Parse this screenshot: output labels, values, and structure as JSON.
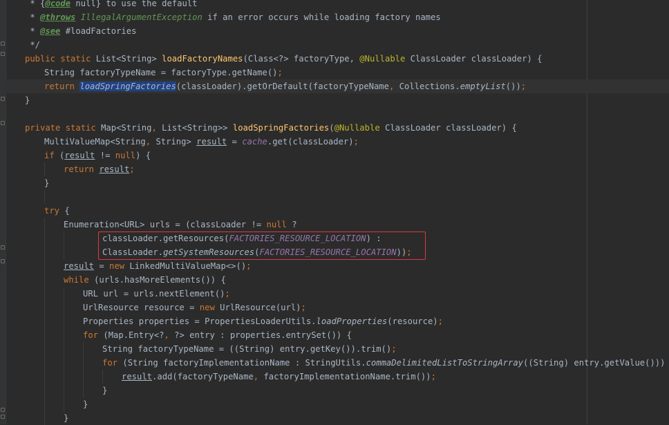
{
  "editor": {
    "language": "java",
    "colors": {
      "background": "#2b2b2b",
      "keyword": "#cc7832",
      "method": "#ffc66d",
      "field": "#9876aa",
      "annotation": "#bbb529",
      "comment": "#629755",
      "selection": "#214283",
      "highlight_box": "#e0383e"
    },
    "lines": [
      [
        {
          "t": " * {"
        },
        {
          "t": "@code",
          "c": "tg"
        },
        {
          "t": " null} to use the default"
        }
      ],
      [
        {
          "t": " * "
        },
        {
          "t": "@throws",
          "c": "tg"
        },
        {
          "t": " IllegalArgumentException",
          "c": "cm"
        },
        {
          "t": " if an error occurs while loading factory names"
        }
      ],
      [
        {
          "t": " * "
        },
        {
          "t": "@see",
          "c": "tg"
        },
        {
          "t": " #loadFactories"
        }
      ],
      [
        {
          "t": " */"
        }
      ],
      [
        {
          "t": "public static ",
          "c": "kw"
        },
        {
          "t": "List<String> "
        },
        {
          "t": "loadFactoryNames",
          "c": "fn"
        },
        {
          "t": "(Class<?> factoryType, "
        },
        {
          "t": "@Nullable",
          "c": "an"
        },
        {
          "t": " ClassLoader classLoader) {"
        }
      ],
      [
        {
          "t": "String factoryTypeName = factoryType.getName()"
        },
        {
          "t": ";",
          "c": "kw"
        }
      ],
      [
        {
          "t": "return ",
          "c": "kw"
        },
        {
          "t": "loadSpringFactories",
          "c": "st hl"
        },
        {
          "t": "(classLoader).getOrDefault(factoryTypeName"
        },
        {
          "t": ", ",
          "c": "kw"
        },
        {
          "t": "Collections."
        },
        {
          "t": "emptyList",
          "c": "st"
        },
        {
          "t": "())"
        },
        {
          "t": ";",
          "c": "kw"
        }
      ],
      [
        {
          "t": "}"
        }
      ],
      [],
      [
        {
          "t": "private static ",
          "c": "kw"
        },
        {
          "t": "Map<String"
        },
        {
          "t": ", ",
          "c": "kw"
        },
        {
          "t": "List<String>> "
        },
        {
          "t": "loadSpringFactories",
          "c": "fn"
        },
        {
          "t": "("
        },
        {
          "t": "@Nullable",
          "c": "an"
        },
        {
          "t": " ClassLoader classLoader) {"
        }
      ],
      [
        {
          "t": "MultiValueMap<String"
        },
        {
          "t": ", ",
          "c": "kw"
        },
        {
          "t": "String> "
        },
        {
          "t": "result",
          "c": "ul"
        },
        {
          "t": " = "
        },
        {
          "t": "cache",
          "c": "fi"
        },
        {
          "t": ".get(classLoader)"
        },
        {
          "t": ";",
          "c": "kw"
        }
      ],
      [
        {
          "t": "if ",
          "c": "kw"
        },
        {
          "t": "("
        },
        {
          "t": "result",
          "c": "ul"
        },
        {
          "t": " != "
        },
        {
          "t": "null",
          "c": "kw"
        },
        {
          "t": ") {"
        }
      ],
      [
        {
          "t": "return ",
          "c": "kw"
        },
        {
          "t": "result",
          "c": "ul"
        },
        {
          "t": ";",
          "c": "kw"
        }
      ],
      [
        {
          "t": "}"
        }
      ],
      [],
      [
        {
          "t": "try ",
          "c": "kw"
        },
        {
          "t": "{"
        }
      ],
      [
        {
          "t": "Enumeration<URL> urls = (classLoader != "
        },
        {
          "t": "null ",
          "c": "kw"
        },
        {
          "t": "?"
        }
      ],
      [
        {
          "t": "classLoader.getResources("
        },
        {
          "t": "FACTORIES_RESOURCE_LOCATION",
          "c": "fi"
        },
        {
          "t": ") :"
        }
      ],
      [
        {
          "t": "ClassLoader."
        },
        {
          "t": "getSystemResources",
          "c": "st"
        },
        {
          "t": "("
        },
        {
          "t": "FACTORIES_RESOURCE_LOCATION",
          "c": "fi"
        },
        {
          "t": "))"
        },
        {
          "t": ";",
          "c": "kw"
        }
      ],
      [
        {
          "t": "result",
          "c": "ul"
        },
        {
          "t": " = "
        },
        {
          "t": "new ",
          "c": "kw"
        },
        {
          "t": "LinkedMultiValueMap<>()"
        },
        {
          "t": ";",
          "c": "kw"
        }
      ],
      [
        {
          "t": "while ",
          "c": "kw"
        },
        {
          "t": "(urls.hasMoreElements()) {"
        }
      ],
      [
        {
          "t": "URL url = urls.nextElement()"
        },
        {
          "t": ";",
          "c": "kw"
        }
      ],
      [
        {
          "t": "UrlResource resource = "
        },
        {
          "t": "new ",
          "c": "kw"
        },
        {
          "t": "UrlResource(url)"
        },
        {
          "t": ";",
          "c": "kw"
        }
      ],
      [
        {
          "t": "Properties properties = PropertiesLoaderUtils."
        },
        {
          "t": "loadProperties",
          "c": "st"
        },
        {
          "t": "(resource)"
        },
        {
          "t": ";",
          "c": "kw"
        }
      ],
      [
        {
          "t": "for ",
          "c": "kw"
        },
        {
          "t": "(Map.Entry<?"
        },
        {
          "t": ", ",
          "c": "kw"
        },
        {
          "t": "?> entry : properties.entrySet()) {"
        }
      ],
      [
        {
          "t": "String factoryTypeName = ((String) entry.getKey()).trim()"
        },
        {
          "t": ";",
          "c": "kw"
        }
      ],
      [
        {
          "t": "for ",
          "c": "kw"
        },
        {
          "t": "(String factoryImplementationName : StringUtils."
        },
        {
          "t": "commaDelimitedListToStringArray",
          "c": "st"
        },
        {
          "t": "((String) entry.getValue())) {"
        }
      ],
      [
        {
          "t": "result",
          "c": "ul"
        },
        {
          "t": ".add(factoryTypeName"
        },
        {
          "t": ", ",
          "c": "kw"
        },
        {
          "t": "factoryImplementationName.trim())"
        },
        {
          "t": ";",
          "c": "kw"
        }
      ],
      [
        {
          "t": "}"
        }
      ],
      [
        {
          "t": "}"
        }
      ],
      [
        {
          "t": "}"
        }
      ]
    ]
  }
}
